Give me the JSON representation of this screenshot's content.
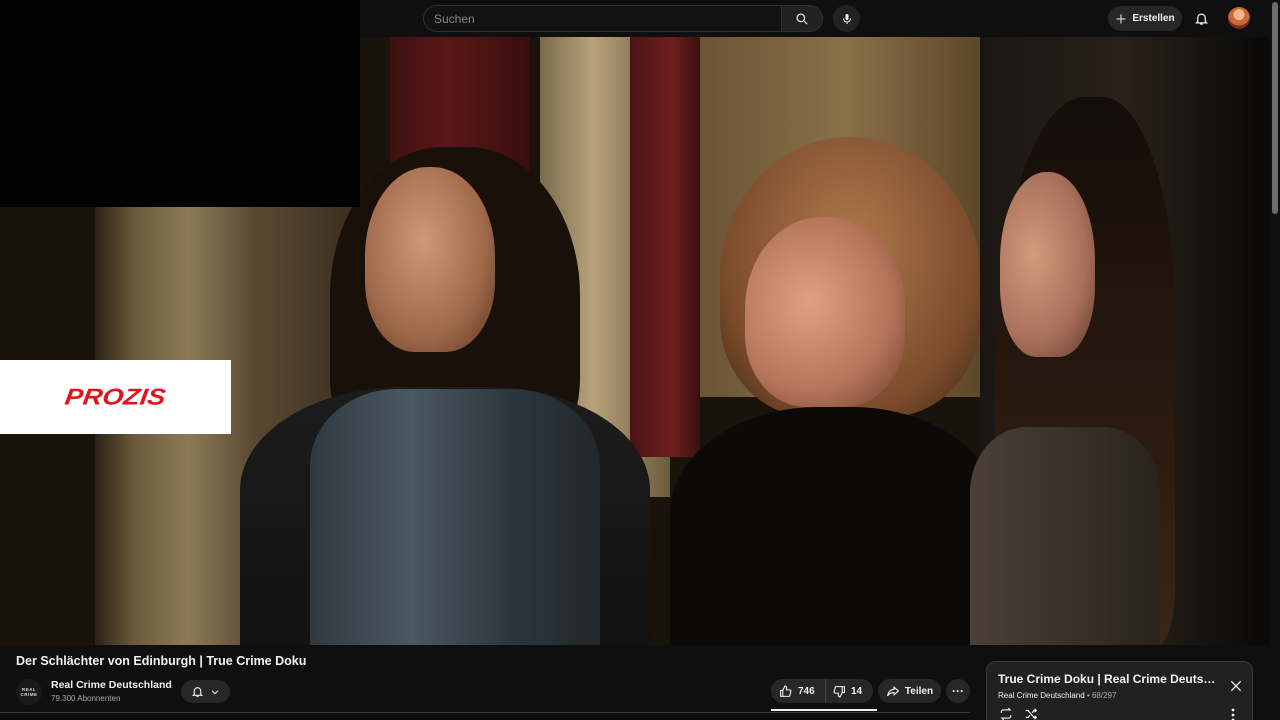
{
  "search": {
    "placeholder": "Suchen"
  },
  "header": {
    "create_label": "Erstellen"
  },
  "ad": {
    "brand": "PROZIS"
  },
  "video": {
    "title": "Der Schlächter von Edinburgh | True Crime Doku"
  },
  "channel": {
    "name": "Real Crime Deutschland",
    "subscribers": "79.300 Abonnenten",
    "avatar_text_line1": "REAL",
    "avatar_text_line2": "CRIME"
  },
  "actions": {
    "likes": "746",
    "dislikes": "14",
    "share_label": "Teilen",
    "more_label": "···"
  },
  "playlist": {
    "title": "True Crime Doku | Real Crime Deutschland",
    "channel": "Real Crime Deutschland",
    "position": "68/297",
    "separator": " • "
  },
  "colors": {
    "background": "#0f0f0f",
    "button_bg": "#272727",
    "ad_red": "#e1141e",
    "text_primary": "#f1f1f1",
    "text_secondary": "#aaaaaa"
  }
}
